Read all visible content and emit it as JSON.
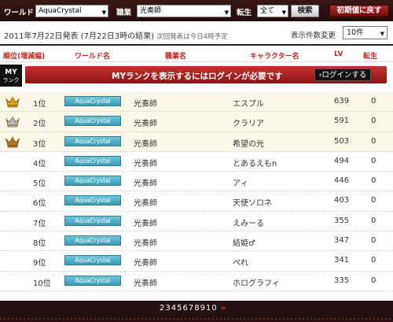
{
  "filters": {
    "world_label": "ワールド",
    "world_value": "AquaCrystal",
    "job_label": "職業",
    "job_value": "光奏師",
    "rebirth_label": "転生",
    "rebirth_value": "全て",
    "search_label": "検索",
    "reset_label": "初期値に戻す",
    "arrow": "▼"
  },
  "info": {
    "date_text": "2011年7月22日発表 (7月22日3時の結果)",
    "next_note": "次回発表は今日4時予定",
    "count_label": "表示件数変更",
    "count_value": "10件"
  },
  "headers": {
    "rank": "順位(増減幅)",
    "world": "ワールド名",
    "job": "職業名",
    "character": "キャラクター名",
    "lv": "LV",
    "rebirth": "転生"
  },
  "my_rank": {
    "badge": "MY",
    "badge_sub": "ランク",
    "message": "MYランクを表示するにはログインが必要です",
    "login_label": "›ログインする"
  },
  "rows": [
    {
      "rank": "1位",
      "world": "AquaCrystal",
      "job": "光奏師",
      "character": "エスプル",
      "lv": "639",
      "rebirth": "0",
      "crown": "gold"
    },
    {
      "rank": "2位",
      "world": "AquaCrystal",
      "job": "光奏師",
      "character": "クラリア",
      "lv": "591",
      "rebirth": "0",
      "crown": "silver"
    },
    {
      "rank": "3位",
      "world": "AquaCrystal",
      "job": "光奏師",
      "character": "希望の光",
      "lv": "503",
      "rebirth": "0",
      "crown": "bronze"
    },
    {
      "rank": "4位",
      "world": "AquaCrystal",
      "job": "光奏師",
      "character": "とあるえもn",
      "lv": "494",
      "rebirth": "0"
    },
    {
      "rank": "5位",
      "world": "AquaCrystal",
      "job": "光奏師",
      "character": "アィ",
      "lv": "446",
      "rebirth": "0"
    },
    {
      "rank": "6位",
      "world": "AquaCrystal",
      "job": "光奏師",
      "character": "天使ソロネ",
      "lv": "403",
      "rebirth": "0"
    },
    {
      "rank": "7位",
      "world": "AquaCrystal",
      "job": "光奏師",
      "character": "えみーる",
      "lv": "355",
      "rebirth": "0"
    },
    {
      "rank": "8位",
      "world": "AquaCrystal",
      "job": "光奏師",
      "character": "結姫♂",
      "lv": "347",
      "rebirth": "0"
    },
    {
      "rank": "9位",
      "world": "AquaCrystal",
      "job": "光奏師",
      "character": "ぺれ",
      "lv": "341",
      "rebirth": "0"
    },
    {
      "rank": "10位",
      "world": "AquaCrystal",
      "job": "光奏師",
      "character": "ホログラフィ",
      "lv": "335",
      "rebirth": "0"
    }
  ],
  "pager": {
    "pages": [
      "2",
      "3",
      "4",
      "5",
      "6",
      "7",
      "8",
      "9",
      "10"
    ],
    "next": "»"
  },
  "colors": {
    "crown_gold": "#d9a420",
    "crown_silver": "#b9b9b9",
    "crown_bronze": "#b8742a",
    "accent_red": "#c32727"
  }
}
